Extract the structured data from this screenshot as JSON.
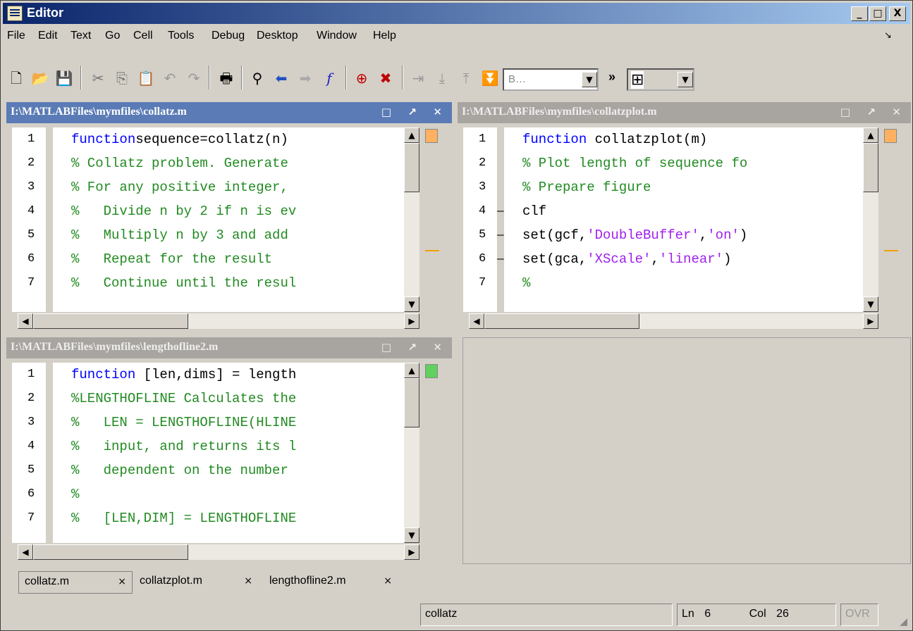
{
  "window": {
    "title": "Editor",
    "min": "_",
    "max": "□",
    "close": "X"
  },
  "menu": [
    "File",
    "Edit",
    "Text",
    "Go",
    "Cell",
    "Tools",
    "Debug",
    "Desktop",
    "Window",
    "Help"
  ],
  "menu_dock_glyph": "↘",
  "toolbar": {
    "combo_value": "B…",
    "more": "»"
  },
  "panes": [
    {
      "title": "I:\\MATLABFiles\\mymfiles\\collatz.m",
      "state": "active",
      "lines": [
        {
          "n": "1",
          "dash": "",
          "segs": [
            [
              "kw",
              "function"
            ],
            [
              "",
              "sequence=collatz(n)"
            ]
          ]
        },
        {
          "n": "2",
          "dash": "",
          "segs": [
            [
              "cm",
              "% Collatz problem. Generate"
            ]
          ]
        },
        {
          "n": "3",
          "dash": "",
          "segs": [
            [
              "cm",
              "% For any positive integer,"
            ]
          ]
        },
        {
          "n": "4",
          "dash": "",
          "segs": [
            [
              "cm",
              "%   Divide n by 2 if n is ev"
            ]
          ]
        },
        {
          "n": "5",
          "dash": "",
          "segs": [
            [
              "cm",
              "%   Multiply n by 3 and add"
            ]
          ]
        },
        {
          "n": "6",
          "dash": "",
          "segs": [
            [
              "cm",
              "%   Repeat for the result"
            ]
          ]
        },
        {
          "n": "7",
          "dash": "",
          "segs": [
            [
              "cm",
              "%   Continue until the resul"
            ]
          ]
        }
      ],
      "marker": "#ffb060"
    },
    {
      "title": "I:\\MATLABFiles\\mymfiles\\collatzplot.m",
      "state": "inactive",
      "lines": [
        {
          "n": "1",
          "dash": "",
          "segs": [
            [
              "kw",
              "function"
            ],
            [
              "",
              " collatzplot(m)"
            ]
          ]
        },
        {
          "n": "2",
          "dash": "",
          "segs": [
            [
              "cm",
              "% Plot length of sequence fo"
            ]
          ]
        },
        {
          "n": "3",
          "dash": "",
          "segs": [
            [
              "cm",
              "% Prepare figure"
            ]
          ]
        },
        {
          "n": "4",
          "dash": "—",
          "segs": [
            [
              "",
              "clf"
            ]
          ]
        },
        {
          "n": "5",
          "dash": "—",
          "segs": [
            [
              "",
              "set(gcf,"
            ],
            [
              "st",
              "'DoubleBuffer'"
            ],
            [
              "",
              ","
            ],
            [
              "st",
              "'on'"
            ],
            [
              "",
              ")"
            ]
          ]
        },
        {
          "n": "6",
          "dash": "—",
          "segs": [
            [
              "",
              "set(gca,"
            ],
            [
              "st",
              "'XScale'"
            ],
            [
              "",
              ","
            ],
            [
              "st",
              "'linear'"
            ],
            [
              "",
              ")"
            ]
          ]
        },
        {
          "n": "7",
          "dash": "",
          "segs": [
            [
              "cm",
              "%"
            ]
          ]
        }
      ],
      "marker": "#ffb060"
    },
    {
      "title": "I:\\MATLABFiles\\mymfiles\\lengthofline2.m",
      "state": "inactive",
      "lines": [
        {
          "n": "1",
          "dash": "",
          "segs": [
            [
              "kw",
              "function"
            ],
            [
              "",
              " [len,dims] = length"
            ]
          ]
        },
        {
          "n": "2",
          "dash": "",
          "segs": [
            [
              "cm",
              "%LENGTHOFLINE Calculates the"
            ]
          ]
        },
        {
          "n": "3",
          "dash": "",
          "segs": [
            [
              "cm",
              "%   LEN = LENGTHOFLINE(HLINE"
            ]
          ]
        },
        {
          "n": "4",
          "dash": "",
          "segs": [
            [
              "cm",
              "%   input, and returns its l"
            ]
          ]
        },
        {
          "n": "5",
          "dash": "",
          "segs": [
            [
              "cm",
              "%   dependent on the number"
            ]
          ]
        },
        {
          "n": "6",
          "dash": "",
          "segs": [
            [
              "cm",
              "%"
            ]
          ]
        },
        {
          "n": "7",
          "dash": "",
          "segs": [
            [
              "cm",
              "%   [LEN,DIM] = LENGTHOFLINE"
            ]
          ]
        }
      ],
      "marker": "#60d060"
    }
  ],
  "tabs": [
    {
      "label": "collatz.m",
      "close": "×"
    },
    {
      "label": "collatzplot.m",
      "close": "×"
    },
    {
      "label": "lengthofline2.m",
      "close": "×"
    }
  ],
  "status": {
    "function": "collatz",
    "ln_label": "Ln",
    "ln": "6",
    "col_label": "Col",
    "col": "26",
    "ovr": "OVR"
  }
}
